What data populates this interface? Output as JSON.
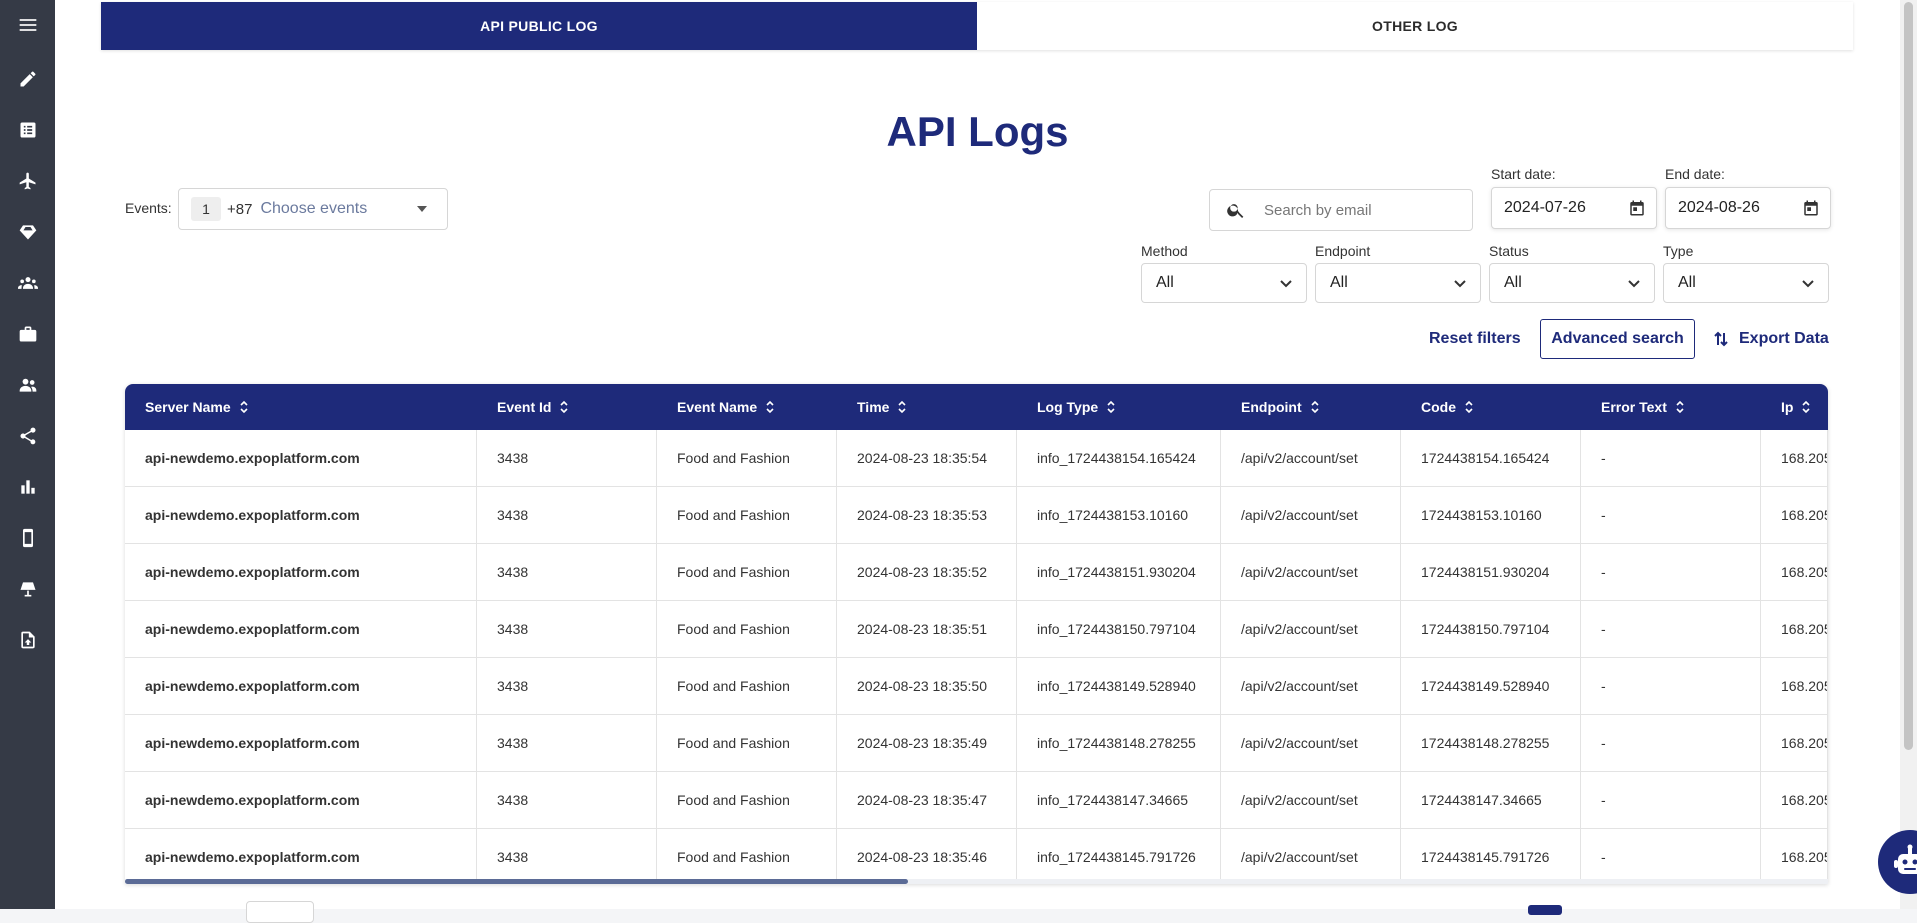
{
  "sidebar": {
    "icons": [
      "menu-icon",
      "pencil-icon",
      "list-icon",
      "plane-icon",
      "diamond-icon",
      "group-icon",
      "briefcase-icon",
      "people-icon",
      "share-icon",
      "bar-chart-icon",
      "mobile-icon",
      "lamp-icon",
      "file-upload-icon"
    ]
  },
  "tabs": [
    {
      "label": "API PUBLIC LOG",
      "active": true
    },
    {
      "label": "OTHER LOG",
      "active": false
    }
  ],
  "page": {
    "title": "API Logs"
  },
  "filters": {
    "events_label": "Events:",
    "events_chip": "1",
    "events_more": "+87",
    "events_placeholder": "Choose events",
    "search_placeholder": "Search by email",
    "start_date_label": "Start date:",
    "start_date": "2024-07-26",
    "end_date_label": "End date:",
    "end_date": "2024-08-26",
    "method_label": "Method",
    "method_value": "All",
    "endpoint_label": "Endpoint",
    "endpoint_value": "All",
    "status_label": "Status",
    "status_value": "All",
    "type_label": "Type",
    "type_value": "All"
  },
  "actions": {
    "reset": "Reset filters",
    "advanced": "Advanced search",
    "export": "Export Data"
  },
  "table": {
    "columns": [
      "Server Name",
      "Event Id",
      "Event Name",
      "Time",
      "Log Type",
      "Endpoint",
      "Code",
      "Error Text",
      "Ip"
    ],
    "rows": [
      [
        "api-newdemo.expoplatform.com",
        "3438",
        "Food and Fashion",
        "2024-08-23 18:35:54",
        "info_1724438154.165424",
        "/api/v2/account/set",
        "1724438154.165424",
        "-",
        "168.205"
      ],
      [
        "api-newdemo.expoplatform.com",
        "3438",
        "Food and Fashion",
        "2024-08-23 18:35:53",
        "info_1724438153.10160",
        "/api/v2/account/set",
        "1724438153.10160",
        "-",
        "168.205"
      ],
      [
        "api-newdemo.expoplatform.com",
        "3438",
        "Food and Fashion",
        "2024-08-23 18:35:52",
        "info_1724438151.930204",
        "/api/v2/account/set",
        "1724438151.930204",
        "-",
        "168.205"
      ],
      [
        "api-newdemo.expoplatform.com",
        "3438",
        "Food and Fashion",
        "2024-08-23 18:35:51",
        "info_1724438150.797104",
        "/api/v2/account/set",
        "1724438150.797104",
        "-",
        "168.205"
      ],
      [
        "api-newdemo.expoplatform.com",
        "3438",
        "Food and Fashion",
        "2024-08-23 18:35:50",
        "info_1724438149.528940",
        "/api/v2/account/set",
        "1724438149.528940",
        "-",
        "168.205"
      ],
      [
        "api-newdemo.expoplatform.com",
        "3438",
        "Food and Fashion",
        "2024-08-23 18:35:49",
        "info_1724438148.278255",
        "/api/v2/account/set",
        "1724438148.278255",
        "-",
        "168.205"
      ],
      [
        "api-newdemo.expoplatform.com",
        "3438",
        "Food and Fashion",
        "2024-08-23 18:35:47",
        "info_1724438147.34665",
        "/api/v2/account/set",
        "1724438147.34665",
        "-",
        "168.205"
      ],
      [
        "api-newdemo.expoplatform.com",
        "3438",
        "Food and Fashion",
        "2024-08-23 18:35:46",
        "info_1724438145.791726",
        "/api/v2/account/set",
        "1724438145.791726",
        "-",
        "168.205"
      ]
    ]
  },
  "colors": {
    "accent": "#1e2a7a",
    "sidebar": "#353a46"
  }
}
